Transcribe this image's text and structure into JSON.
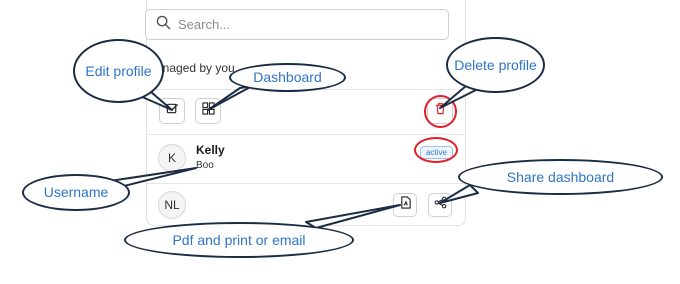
{
  "search": {
    "placeholder": "Search..."
  },
  "section": {
    "label": "Managed by you"
  },
  "users": [
    {
      "initial": "K",
      "name": "Kelly",
      "subtitle": "Boo",
      "status": "active"
    },
    {
      "initial": "NL"
    }
  ],
  "annotations": {
    "edit_profile": "Edit profile",
    "dashboard": "Dashboard",
    "delete_profile": "Delete profile",
    "username": "Username",
    "share_dashboard": "Share dashboard",
    "pdf_print_email": "Pdf and print or email"
  },
  "colors": {
    "callout_text": "#2e75c8",
    "callout_border": "#1b2c44",
    "highlight_ring": "#e0202a",
    "delete_icon": "#e0202a",
    "badge_text": "#2f7ad0"
  },
  "icons": [
    "search-icon",
    "edit-icon",
    "dashboard-icon",
    "trash-icon",
    "pdf-icon",
    "share-icon"
  ]
}
